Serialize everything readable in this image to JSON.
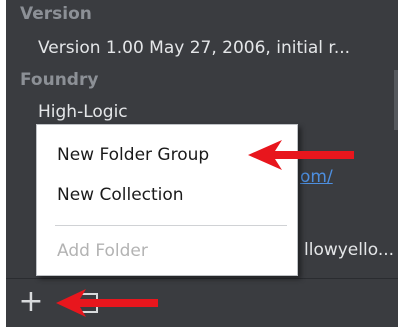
{
  "info_panel": {
    "version_label": "Version",
    "version_value": "Version 1.00 May 27, 2006, initial r...",
    "foundry_label": "Foundry",
    "foundry_value": "High-Logic",
    "link_fragment": "om/",
    "partial_text": "llowyello..."
  },
  "context_menu": {
    "items": [
      {
        "label": "New Folder Group",
        "enabled": true
      },
      {
        "label": "New Collection",
        "enabled": true
      },
      {
        "label": "Add Folder",
        "enabled": false
      }
    ]
  },
  "toolbar": {
    "add_glyph": "+"
  },
  "colors": {
    "panel_background": "#3a3c40",
    "annotation_arrow": "#e8161d",
    "link": "#4d8fe0"
  }
}
